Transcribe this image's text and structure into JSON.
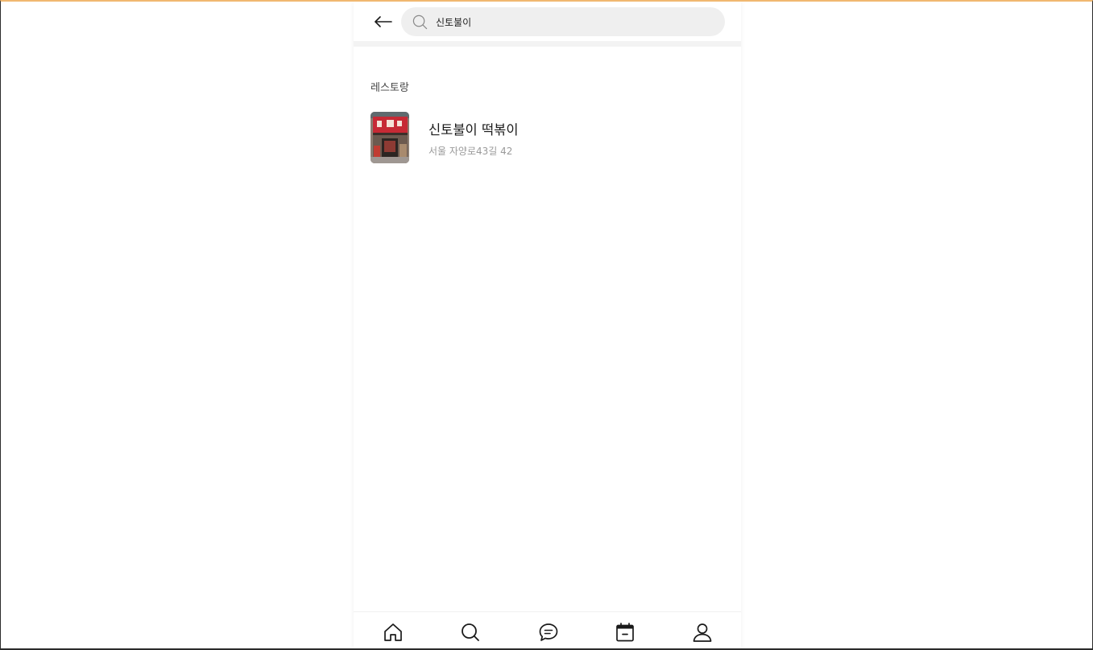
{
  "search": {
    "query": "신토불이",
    "back_icon": "arrow-left-icon",
    "search_icon": "search-icon"
  },
  "results": {
    "section_title": "레스토랑",
    "items": [
      {
        "name": "신토불이 떡볶이",
        "address": "서울 자양로43길 42",
        "thumbnail": "storefront-photo"
      }
    ]
  },
  "bottom_nav": {
    "items": [
      {
        "id": "home",
        "icon": "home-icon"
      },
      {
        "id": "search",
        "icon": "search-icon"
      },
      {
        "id": "chat",
        "icon": "chat-icon"
      },
      {
        "id": "calendar",
        "icon": "calendar-icon"
      },
      {
        "id": "profile",
        "icon": "profile-icon"
      }
    ]
  },
  "colors": {
    "search_bg": "#efefef",
    "divider": "#f3f3f3",
    "text_primary": "#1a1a1a",
    "text_secondary": "#9a9a9a",
    "window_top_border": "#f1b870"
  }
}
